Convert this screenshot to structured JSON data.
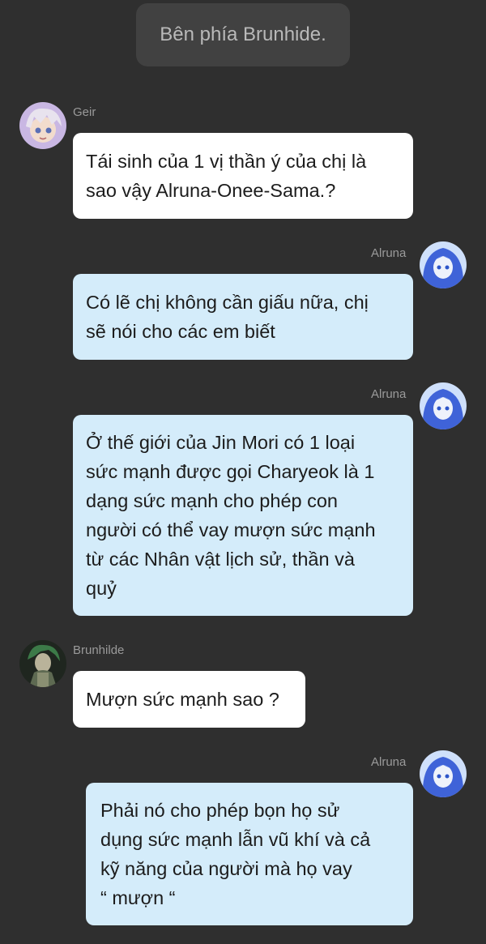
{
  "header": {
    "text": "Bên phía Brunhide."
  },
  "messages": [
    {
      "sender": "Geir",
      "lines": [
        "Tái sinh của 1 vị thần ý của chị là",
        "sao vậy Alruna-Onee-Sama.?"
      ]
    },
    {
      "sender": "Alruna",
      "lines": [
        "Có lẽ chị không cần giấu nữa, chị",
        "sẽ nói cho các em biết"
      ]
    },
    {
      "sender": "Alruna",
      "lines": [
        "Ở thế giới của Jin Mori có 1 loại",
        "sức mạnh được gọi Charyeok là 1",
        "dạng sức mạnh cho phép con",
        "người có thể vay mượn sức mạnh",
        "từ các Nhân vật lịch sử, thần và",
        "quỷ"
      ]
    },
    {
      "sender": "Brunhilde",
      "lines": [
        "Mượn sức mạnh sao ?"
      ]
    },
    {
      "sender": "Alruna",
      "lines": [
        "Phải nó cho phép bọn họ sử",
        "dụng sức mạnh lẫn vũ khí và cả",
        "kỹ năng của người mà họ vay",
        "“ mượn “"
      ]
    }
  ],
  "colors": {
    "background": "#2f2f2f",
    "header_pill": "#414141",
    "bubble_incoming": "#ffffff",
    "bubble_outgoing": "#d4ecfa"
  },
  "icons": {
    "geir_avatar": "avatar-geir-icon",
    "alruna_avatar": "avatar-alruna-icon",
    "brunhilde_avatar": "avatar-brunhilde-icon"
  }
}
